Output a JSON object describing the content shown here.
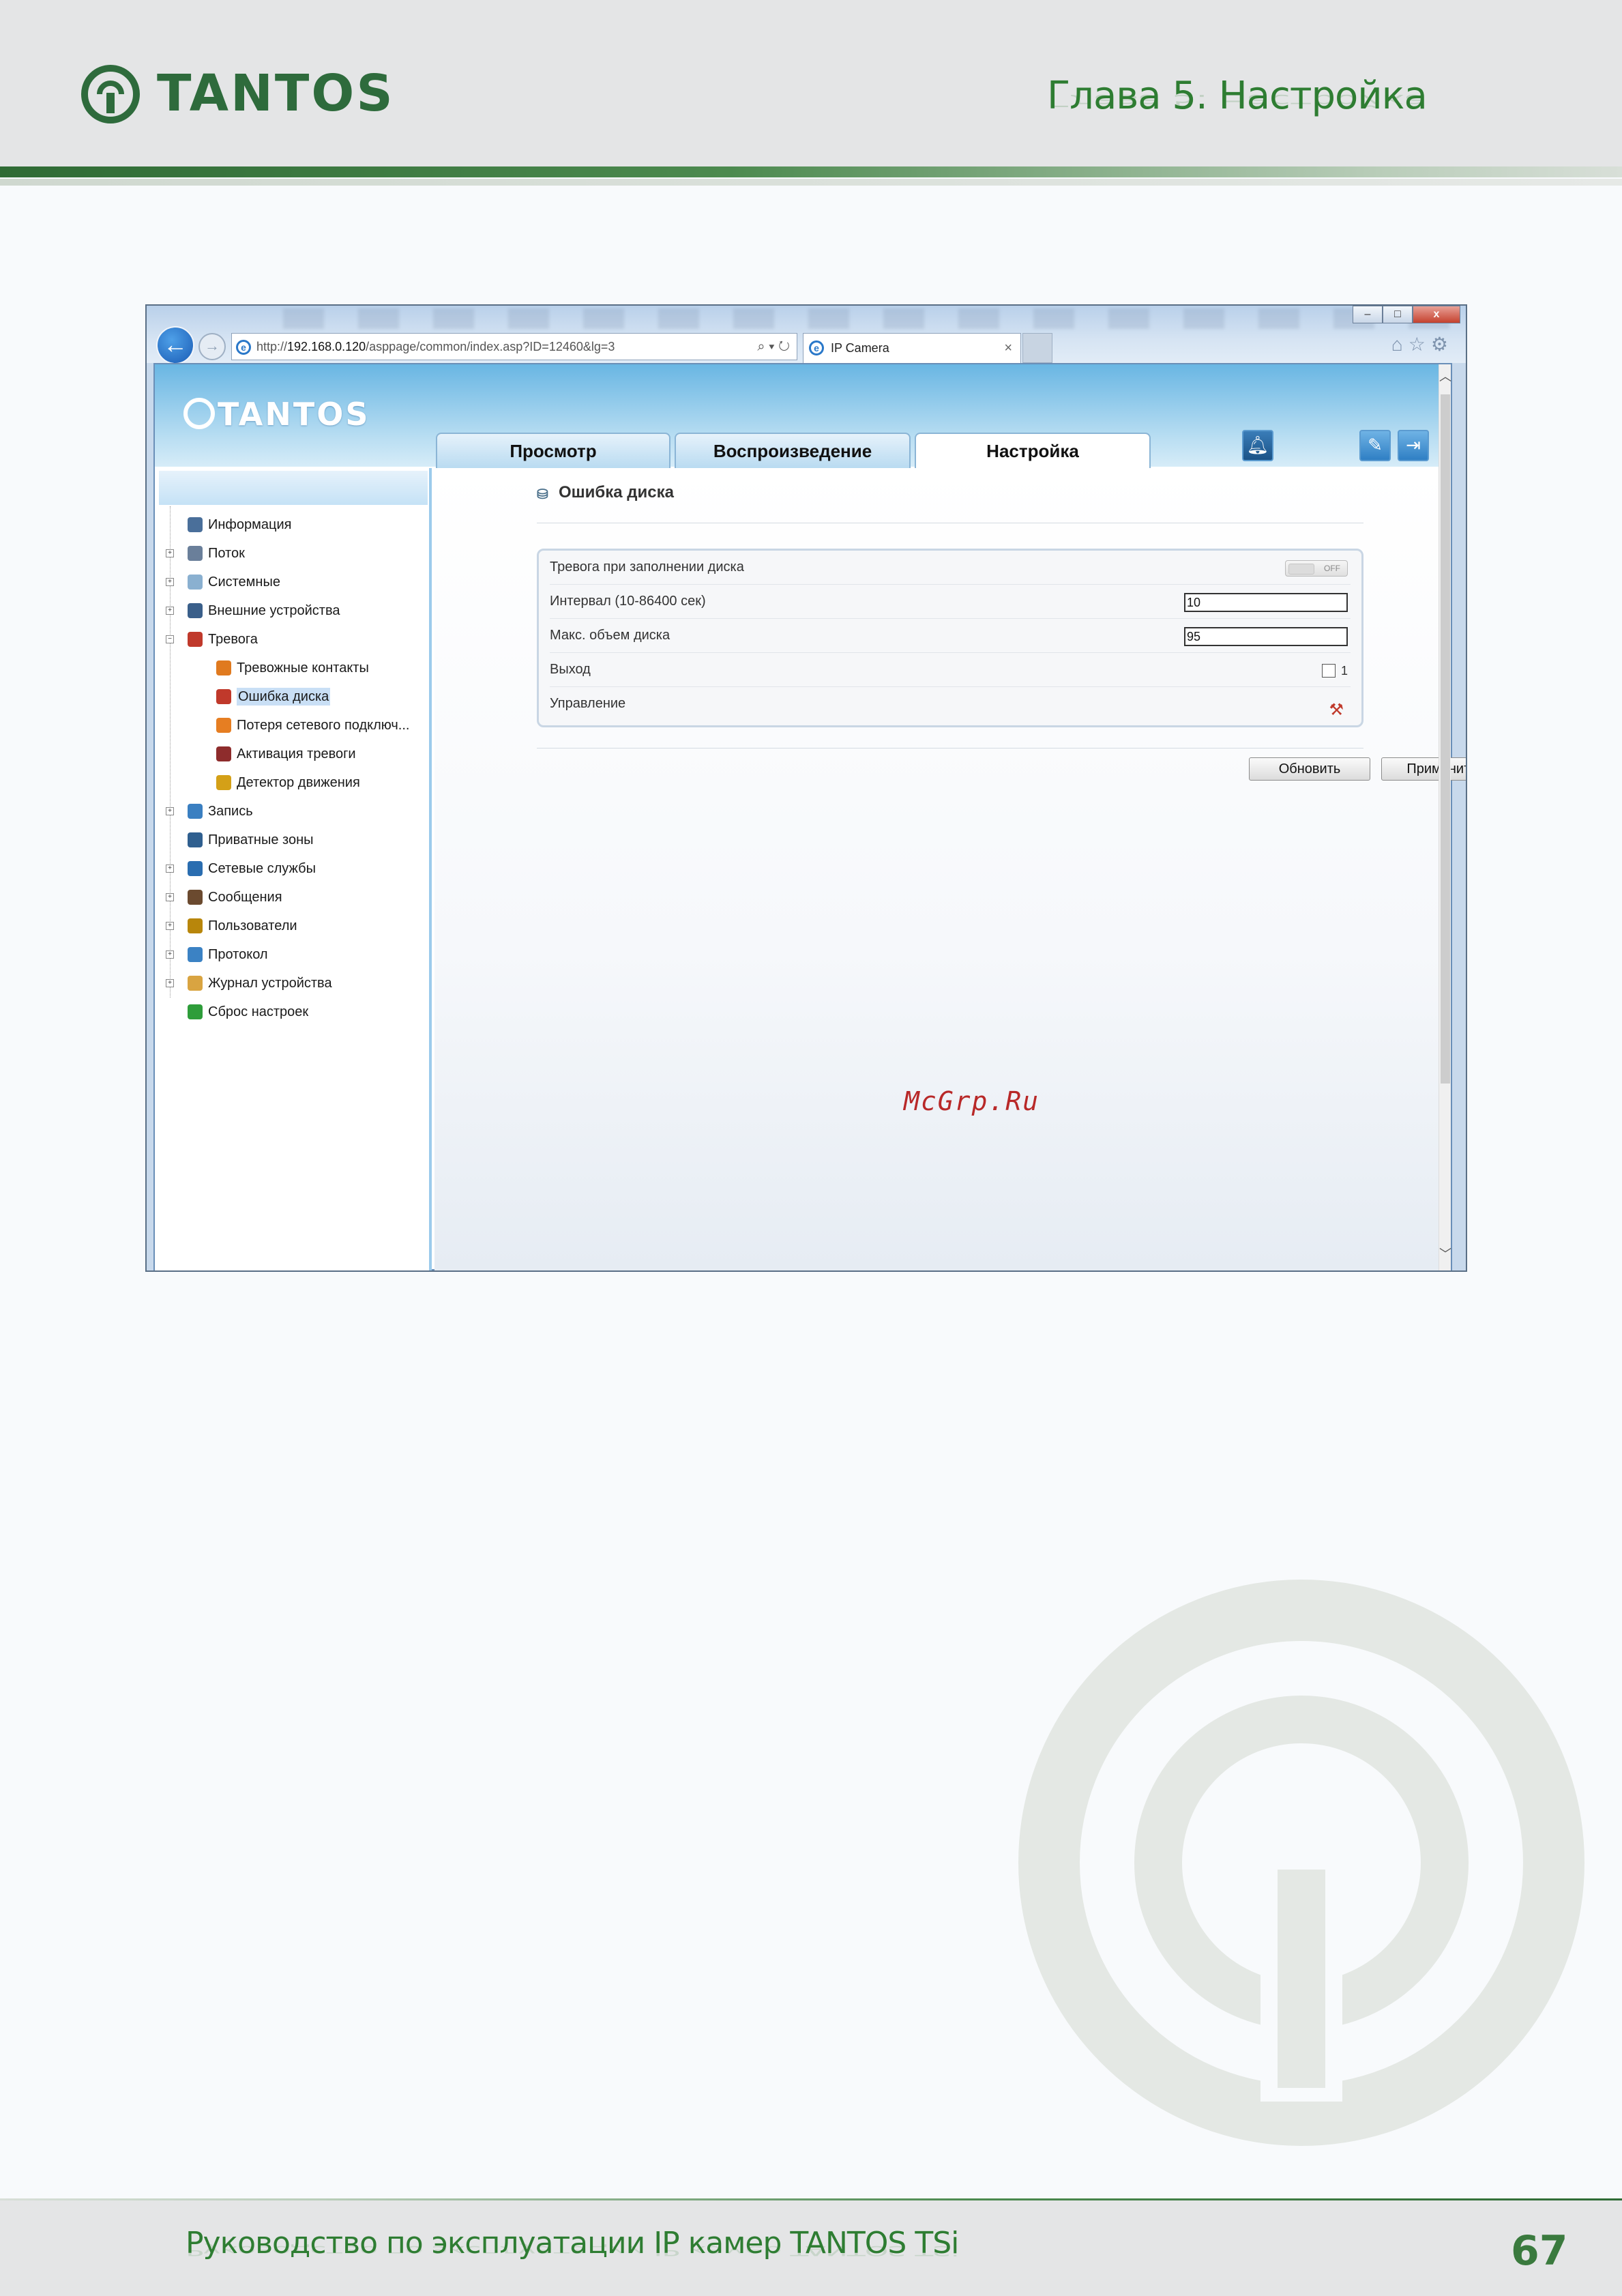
{
  "page": {
    "header": {
      "brand": "TANTOS",
      "chapter_title": "Глава 5. Настройка"
    },
    "footer": {
      "manual_title": "Руководство по эксплуатации IP камер TANTOS TSi",
      "page_number": "67"
    }
  },
  "browser": {
    "window_controls": {
      "minimize": "–",
      "maximize": "□",
      "close": "x"
    },
    "address": {
      "prefix": "http://",
      "host": "192.168.0.120",
      "path": "/asppage/common/index.asp?ID=12460&lg=3",
      "tools": "⌕ ▾ ↻"
    },
    "tab": {
      "title": "IP Camera",
      "close": "×"
    },
    "icons": [
      "home-icon",
      "star-icon",
      "gear-icon"
    ]
  },
  "app": {
    "logo": "TANTOS",
    "nav_tabs": [
      {
        "label": "Просмотр",
        "active": false
      },
      {
        "label": "Воспроизведение",
        "active": false
      },
      {
        "label": "Настройка",
        "active": true
      }
    ],
    "sidebar": {
      "items": [
        {
          "label": "Информация",
          "level": 0,
          "expander": false,
          "icon_color": "#4a6f9a"
        },
        {
          "label": "Поток",
          "level": 0,
          "expander": true,
          "icon_color": "#6a7f9a"
        },
        {
          "label": "Системные",
          "level": 0,
          "expander": true,
          "icon_color": "#8ab0d0"
        },
        {
          "label": "Внешние устройства",
          "level": 0,
          "expander": true,
          "icon_color": "#3a5f8a"
        },
        {
          "label": "Тревога",
          "level": 0,
          "expander": true,
          "expanded": true,
          "icon_color": "#c0392b"
        },
        {
          "label": "Тревожные контакты",
          "level": 1,
          "icon_color": "#e07a1f"
        },
        {
          "label": "Ошибка диска",
          "level": 1,
          "selected": true,
          "icon_color": "#c0392b"
        },
        {
          "label": "Потеря сетевого подключ...",
          "level": 1,
          "icon_color": "#e67e22"
        },
        {
          "label": "Активация тревоги",
          "level": 1,
          "icon_color": "#8e2c2c"
        },
        {
          "label": "Детектор движения",
          "level": 1,
          "icon_color": "#d4a017"
        },
        {
          "label": "Запись",
          "level": 0,
          "expander": true,
          "icon_color": "#3a7fc1"
        },
        {
          "label": "Приватные зоны",
          "level": 0,
          "expander": false,
          "icon_color": "#2f5f8f"
        },
        {
          "label": "Сетевые службы",
          "level": 0,
          "expander": true,
          "icon_color": "#2a6db0"
        },
        {
          "label": "Сообщения",
          "level": 0,
          "expander": true,
          "icon_color": "#6b4a2f"
        },
        {
          "label": "Пользователи",
          "level": 0,
          "expander": true,
          "icon_color": "#b8860b"
        },
        {
          "label": "Протокол",
          "level": 0,
          "expander": true,
          "icon_color": "#3b82c4"
        },
        {
          "label": "Журнал устройства",
          "level": 0,
          "expander": true,
          "icon_color": "#d9a441"
        },
        {
          "label": "Сброс настроек",
          "level": 0,
          "expander": false,
          "icon_color": "#2e9d3a"
        }
      ]
    },
    "panel": {
      "title": "Ошибка диска",
      "rows": [
        {
          "label": "Тревога при заполнении диска",
          "control": "toggle",
          "value": "OFF"
        },
        {
          "label": "Интервал (10-86400 сек)",
          "control": "input",
          "value": "10"
        },
        {
          "label": "Макс. объем диска",
          "control": "input",
          "value": "95"
        },
        {
          "label": "Выход",
          "control": "checkbox",
          "checked": false,
          "value": "1"
        },
        {
          "label": "Управление",
          "control": "icon",
          "icon": "tools-icon"
        }
      ],
      "buttons": {
        "refresh": "Обновить",
        "apply": "Применить"
      }
    },
    "watermark_text": "McGrp.Ru"
  }
}
